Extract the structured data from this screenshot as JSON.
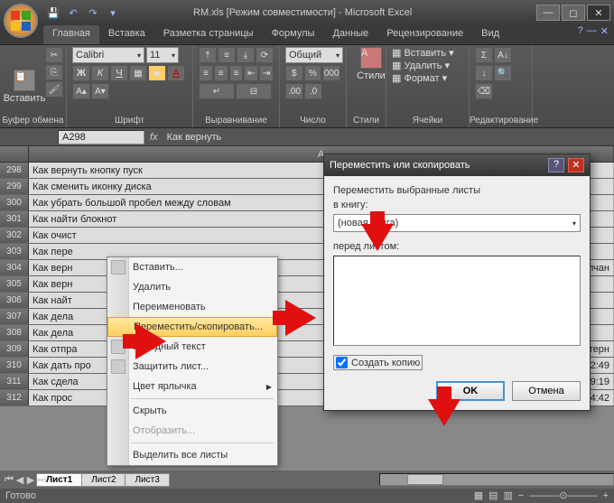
{
  "title": "RM.xls  [Режим совместимости] - Microsoft Excel",
  "tabs": [
    "Главная",
    "Вставка",
    "Разметка страницы",
    "Формулы",
    "Данные",
    "Рецензирование",
    "Вид"
  ],
  "groups": {
    "clipboard": {
      "label": "Буфер обмена",
      "paste": "Вставить"
    },
    "font": {
      "label": "Шрифт",
      "name": "Calibri",
      "size": "11"
    },
    "align": {
      "label": "Выравнивание"
    },
    "number": {
      "label": "Число",
      "format": "Общий"
    },
    "styles": {
      "label": "Стили",
      "btn": "Стили"
    },
    "cells": {
      "label": "Ячейки",
      "insert": "Вставить",
      "delete": "Удалить",
      "format": "Формат"
    },
    "edit": {
      "label": "Редактирование"
    }
  },
  "namebox": "A298",
  "formula": "Как вернуть",
  "colhead": "A",
  "rows": [
    {
      "n": "298",
      "a": "Как вернуть кнопку пуск",
      "d": ""
    },
    {
      "n": "299",
      "a": "Как сменить иконку диска",
      "d": ""
    },
    {
      "n": "300",
      "a": "Как убрать большой пробел между словам",
      "d": ""
    },
    {
      "n": "301",
      "a": "Как найти блокнот",
      "d": ""
    },
    {
      "n": "302",
      "a": "Как очист",
      "d": ""
    },
    {
      "n": "303",
      "a": "Как пере",
      "d": ""
    },
    {
      "n": "304",
      "a": "Как верн",
      "d": "элчан"
    },
    {
      "n": "305",
      "a": "Как верн",
      "d": ""
    },
    {
      "n": "306",
      "a": "Как найт",
      "d": ""
    },
    {
      "n": "307",
      "a": "Как дела",
      "d": ""
    },
    {
      "n": "308",
      "a": "Как дела",
      "d": ""
    },
    {
      "n": "309",
      "a": "Как отпра",
      "d": "терн"
    },
    {
      "n": "310",
      "a": "Как дать про",
      "d": ".2011 22:49"
    },
    {
      "n": "311",
      "a": "Как сдела",
      "d": "02.07.2011 9:19"
    },
    {
      "n": "312",
      "a": "Как прос",
      "d": "02.07.2011 14:42"
    }
  ],
  "sheettabs": [
    "Лист1",
    "Лист2",
    "Лист3"
  ],
  "status": "Готово",
  "contextmenu": [
    {
      "label": "Вставить...",
      "icon": true
    },
    {
      "label": "Удалить",
      "icon": false
    },
    {
      "label": "Переименовать",
      "icon": false
    },
    {
      "label": "Переместить/скопировать...",
      "icon": false,
      "hl": true
    },
    {
      "label": "Исходный текст",
      "icon": true
    },
    {
      "label": "Защитить лист...",
      "icon": true
    },
    {
      "label": "Цвет ярлычка",
      "icon": false,
      "sub": true
    },
    {
      "label": "Скрыть",
      "icon": false
    },
    {
      "label": "Отобразить...",
      "icon": false,
      "dis": true
    },
    {
      "label": "Выделить все листы",
      "icon": false
    }
  ],
  "dialog": {
    "title": "Переместить или скопировать",
    "label1": "Переместить выбранные листы",
    "label2": "в книгу:",
    "book": "(новая книга)",
    "label3": "перед листом:",
    "check": "Создать копию",
    "ok": "OK",
    "cancel": "Отмена"
  }
}
